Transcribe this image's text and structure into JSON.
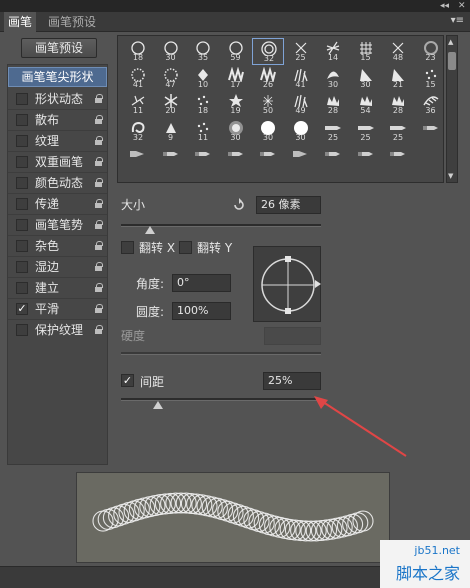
{
  "tabs": [
    {
      "label": "画笔",
      "active": true
    },
    {
      "label": "画笔预设",
      "active": false
    }
  ],
  "topbar": {
    "collapse_glyph": "◂◂",
    "close_glyph": "✕"
  },
  "panel_menu": "▾≡",
  "preset_button": "画笔预设",
  "sidebar": {
    "items": [
      {
        "label": "画笔笔尖形状",
        "checked": null,
        "lock": false,
        "selected": true
      },
      {
        "label": "形状动态",
        "checked": false,
        "lock": true
      },
      {
        "label": "散布",
        "checked": false,
        "lock": true
      },
      {
        "label": "纹理",
        "checked": false,
        "lock": true
      },
      {
        "label": "双重画笔",
        "checked": false,
        "lock": true
      },
      {
        "label": "颜色动态",
        "checked": false,
        "lock": true
      },
      {
        "label": "传递",
        "checked": false,
        "lock": true
      },
      {
        "label": "画笔笔势",
        "checked": false,
        "lock": true
      },
      {
        "label": "杂色",
        "checked": false,
        "lock": true
      },
      {
        "label": "湿边",
        "checked": false,
        "lock": true
      },
      {
        "label": "建立",
        "checked": false,
        "lock": true
      },
      {
        "label": "平滑",
        "checked": true,
        "lock": true
      },
      {
        "label": "保护纹理",
        "checked": false,
        "lock": true
      }
    ]
  },
  "brushes": [
    {
      "size": "18",
      "icon": "ring-thin"
    },
    {
      "size": "30",
      "icon": "ring-thin"
    },
    {
      "size": "35",
      "icon": "ring-thin"
    },
    {
      "size": "59",
      "icon": "ring-thin"
    },
    {
      "size": "32",
      "icon": "ring-double",
      "selected": true
    },
    {
      "size": "25",
      "icon": "x-cross"
    },
    {
      "size": "14",
      "icon": "hash-cross"
    },
    {
      "size": "15",
      "icon": "grid-hash"
    },
    {
      "size": "48",
      "icon": "x-cross"
    },
    {
      "size": "23",
      "icon": "ring-soft"
    },
    {
      "size": "41",
      "icon": "ring-dotted"
    },
    {
      "size": "47",
      "icon": "ring-dotted"
    },
    {
      "size": "10",
      "icon": "diamond"
    },
    {
      "size": "17",
      "icon": "zigzag"
    },
    {
      "size": "26",
      "icon": "zigzag"
    },
    {
      "size": "41",
      "icon": "grass"
    },
    {
      "size": "30",
      "icon": "leaf"
    },
    {
      "size": "30",
      "icon": "fan"
    },
    {
      "size": "21",
      "icon": "fan"
    },
    {
      "size": "15",
      "icon": "dots"
    },
    {
      "size": "11",
      "icon": "twig"
    },
    {
      "size": "20",
      "icon": "snowflake"
    },
    {
      "size": "18",
      "icon": "dots"
    },
    {
      "size": "19",
      "icon": "star"
    },
    {
      "size": "50",
      "icon": "star-thin"
    },
    {
      "size": "49",
      "icon": "grass"
    },
    {
      "size": "28",
      "icon": "rough"
    },
    {
      "size": "54",
      "icon": "rough"
    },
    {
      "size": "28",
      "icon": "rough"
    },
    {
      "size": "36",
      "icon": "feather"
    },
    {
      "size": "32",
      "icon": "swirl"
    },
    {
      "size": "9",
      "icon": "triangle"
    },
    {
      "size": "11",
      "icon": "dots"
    },
    {
      "size": "30",
      "icon": "soft-round"
    },
    {
      "size": "30",
      "icon": "hard-round"
    },
    {
      "size": "30",
      "icon": "hard-round"
    },
    {
      "size": "25",
      "icon": "chalk"
    },
    {
      "size": "25",
      "icon": "chalk"
    },
    {
      "size": "25",
      "icon": "chalk"
    },
    {
      "size": "",
      "icon": "pencil-tip"
    },
    {
      "size": "",
      "icon": "airbrush"
    },
    {
      "size": "",
      "icon": "pencil-tip"
    },
    {
      "size": "",
      "icon": "pencil-tip"
    },
    {
      "size": "",
      "icon": "pencil-tip"
    },
    {
      "size": "",
      "icon": "pencil-tip"
    },
    {
      "size": "",
      "icon": "airbrush"
    },
    {
      "size": "",
      "icon": "pencil-tip"
    },
    {
      "size": "",
      "icon": "pencil-tip"
    },
    {
      "size": "",
      "icon": "pencil-tip"
    }
  ],
  "size": {
    "label": "大小",
    "value": "26 像素",
    "slider_fraction": 0.1
  },
  "flip": {
    "x_label": "翻转 X",
    "y_label": "翻转 Y",
    "x_checked": false,
    "y_checked": false
  },
  "angle": {
    "label": "角度:",
    "value": "0°"
  },
  "roundness": {
    "label": "圆度:",
    "value": "100%"
  },
  "hardness": {
    "label": "硬度",
    "value": ""
  },
  "spacing": {
    "label": "间距",
    "value": "25%",
    "checked": true,
    "slider_fraction": 0.12
  },
  "colors": {
    "panel": "#535353",
    "selection": "#4e6a90",
    "arrow": "#e04646"
  },
  "watermark": {
    "line1": "jb51.net",
    "line2": "脚本之家"
  }
}
